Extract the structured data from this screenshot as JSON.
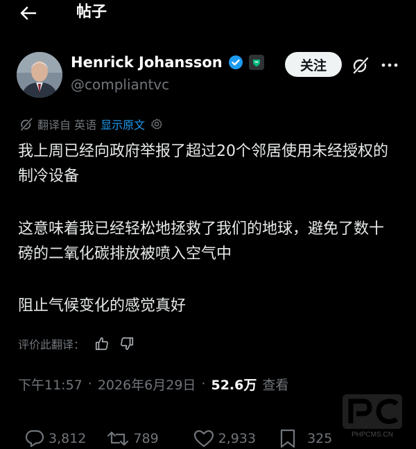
{
  "header": {
    "title": "帖子"
  },
  "author": {
    "name": "Henrick Johansson",
    "handle": "@compliantvc",
    "follow_label": "关注"
  },
  "translation": {
    "label": "翻译自 英语",
    "show_original": "显示原文"
  },
  "post": {
    "paragraphs": [
      "我上周已经向政府举报了超过20个邻居使用未经授权的制冷设备",
      "这意味着我已经轻松地拯救了我们的地球，避免了数十磅的二氧化碳排放被喷入空气中",
      "阻止气候变化的感觉真好"
    ]
  },
  "rate_translation": {
    "label": "评价此翻译："
  },
  "meta": {
    "time": "下午11:57",
    "date": "2026年6月29日",
    "views": "52.6万",
    "views_label": "查看"
  },
  "actions": {
    "replies": "3,812",
    "reposts": "789",
    "likes": "2,933",
    "bookmarks": "325"
  },
  "watermark": {
    "text": "PHPCMS.CN"
  },
  "colors": {
    "background": "#000000",
    "text": "#e7e9ea",
    "secondary": "#71767b",
    "link": "#1d9bf0",
    "verified": "#1d9bf0",
    "follow_bg": "#eff3f4"
  }
}
